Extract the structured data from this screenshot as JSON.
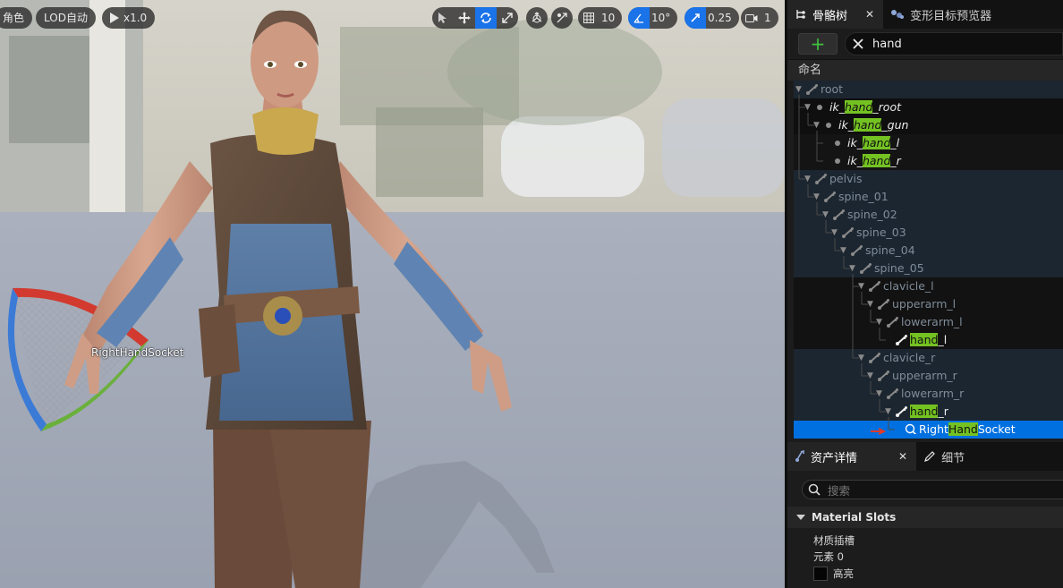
{
  "viewport": {
    "character_chip": "角色",
    "lod_chip": "LOD自动",
    "play_speed": "x1.0",
    "grid_size": "10",
    "rotation_snap": "10°",
    "scale_snap": "0.25",
    "camera_speed": "1",
    "socket_label": "RightHandSocket"
  },
  "tabs": {
    "skeleton_tree": "骨骼树",
    "morph_preview": "变形目标预览器",
    "asset_details": "资产详情",
    "details": "细节"
  },
  "search": {
    "value": "hand",
    "placeholder": "搜索"
  },
  "column_header": "命名",
  "tree": [
    {
      "pre": "root",
      "hl": "",
      "post": "",
      "style": "dim"
    },
    {
      "pre": "ik_",
      "hl": "hand",
      "post": "_root",
      "style": "bright-italic"
    },
    {
      "pre": "ik_",
      "hl": "hand",
      "post": "_gun",
      "style": "bright-italic"
    },
    {
      "pre": "ik_",
      "hl": "hand",
      "post": "_l",
      "style": "bright-italic"
    },
    {
      "pre": "ik_",
      "hl": "hand",
      "post": "_r",
      "style": "bright-italic"
    },
    {
      "pre": "pelvis",
      "hl": "",
      "post": "",
      "style": "dim"
    },
    {
      "pre": "spine_01",
      "hl": "",
      "post": "",
      "style": "dim"
    },
    {
      "pre": "spine_02",
      "hl": "",
      "post": "",
      "style": "dim"
    },
    {
      "pre": "spine_03",
      "hl": "",
      "post": "",
      "style": "dim"
    },
    {
      "pre": "spine_04",
      "hl": "",
      "post": "",
      "style": "dim"
    },
    {
      "pre": "spine_05",
      "hl": "",
      "post": "",
      "style": "dim"
    },
    {
      "pre": "clavicle_l",
      "hl": "",
      "post": "",
      "style": "dim"
    },
    {
      "pre": "upperarm_l",
      "hl": "",
      "post": "",
      "style": "dim"
    },
    {
      "pre": "lowerarm_l",
      "hl": "",
      "post": "",
      "style": "dim"
    },
    {
      "pre": "",
      "hl": "hand",
      "post": "_l",
      "style": "bright"
    },
    {
      "pre": "clavicle_r",
      "hl": "",
      "post": "",
      "style": "dim"
    },
    {
      "pre": "upperarm_r",
      "hl": "",
      "post": "",
      "style": "dim"
    },
    {
      "pre": "lowerarm_r",
      "hl": "",
      "post": "",
      "style": "dim"
    },
    {
      "pre": "",
      "hl": "hand",
      "post": "_r",
      "style": "bright"
    },
    {
      "pre": "Right",
      "hl": "Hand",
      "post": "Socket",
      "style": "selected"
    }
  ],
  "details": {
    "section": "Material Slots",
    "prop_label": "材质插槽",
    "element_label": "元素 0",
    "highlight_label": "高亮"
  },
  "colors": {
    "accent": "#0070e0",
    "search_highlight": "#74c222",
    "add_green": "#3fc23f"
  }
}
